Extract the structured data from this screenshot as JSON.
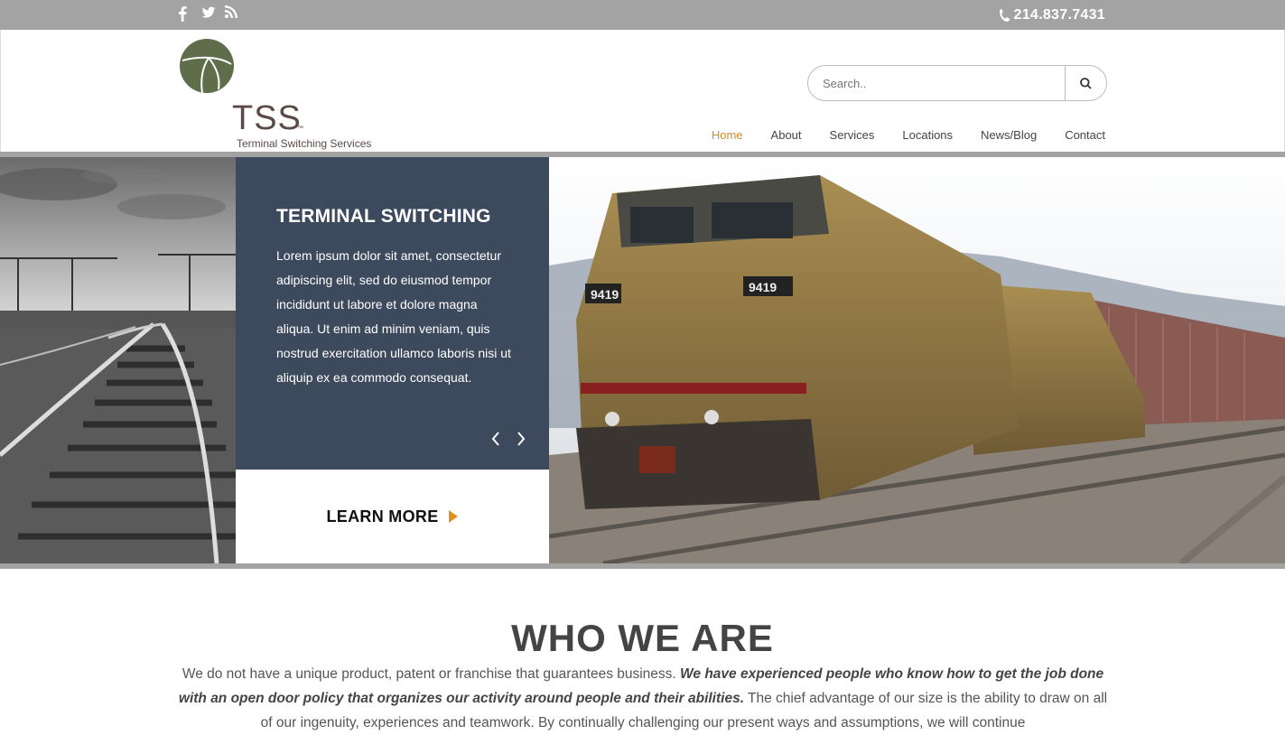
{
  "topbar": {
    "social_icons": [
      "facebook-icon",
      "twitter-icon",
      "rss-icon"
    ],
    "phone": "214.837.7431"
  },
  "logo": {
    "name": "TSS",
    "tm": "™",
    "subtitle": "Terminal Switching Services"
  },
  "search": {
    "placeholder": "Search.."
  },
  "nav": {
    "items": [
      {
        "label": "Home",
        "active": true
      },
      {
        "label": "About"
      },
      {
        "label": "Services"
      },
      {
        "label": "Locations"
      },
      {
        "label": "News/Blog"
      },
      {
        "label": "Contact"
      }
    ]
  },
  "hero": {
    "title": "TERMINAL SWITCHING",
    "body": "Lorem ipsum dolor sit amet, consectetur adipiscing elit, sed do eiusmod tempor incididunt ut labore et dolore magna aliqua. Ut enim ad minim veniam, quis nostrud exercitation ullamco laboris nisi ut aliquip ex ea commodo consequat.",
    "cta": "LEARN MORE"
  },
  "who": {
    "title": "WHO WE ARE",
    "text_start": "We do not have a unique product, patent or franchise that guarantees business. ",
    "text_emphasis": "We have experienced people who know how to get the job done with an open door policy that organizes our activity around people and their abilities.",
    "text_end": " The chief advantage of our size is the ability to draw on all of our ingenuity, experiences and teamwork. By continually challenging our present ways and assumptions, we will continue"
  },
  "colors": {
    "topbar": "#a3a3a3",
    "panel": "#3d495d",
    "accent": "#d98a2d",
    "logo_green": "#5e6e4a"
  }
}
